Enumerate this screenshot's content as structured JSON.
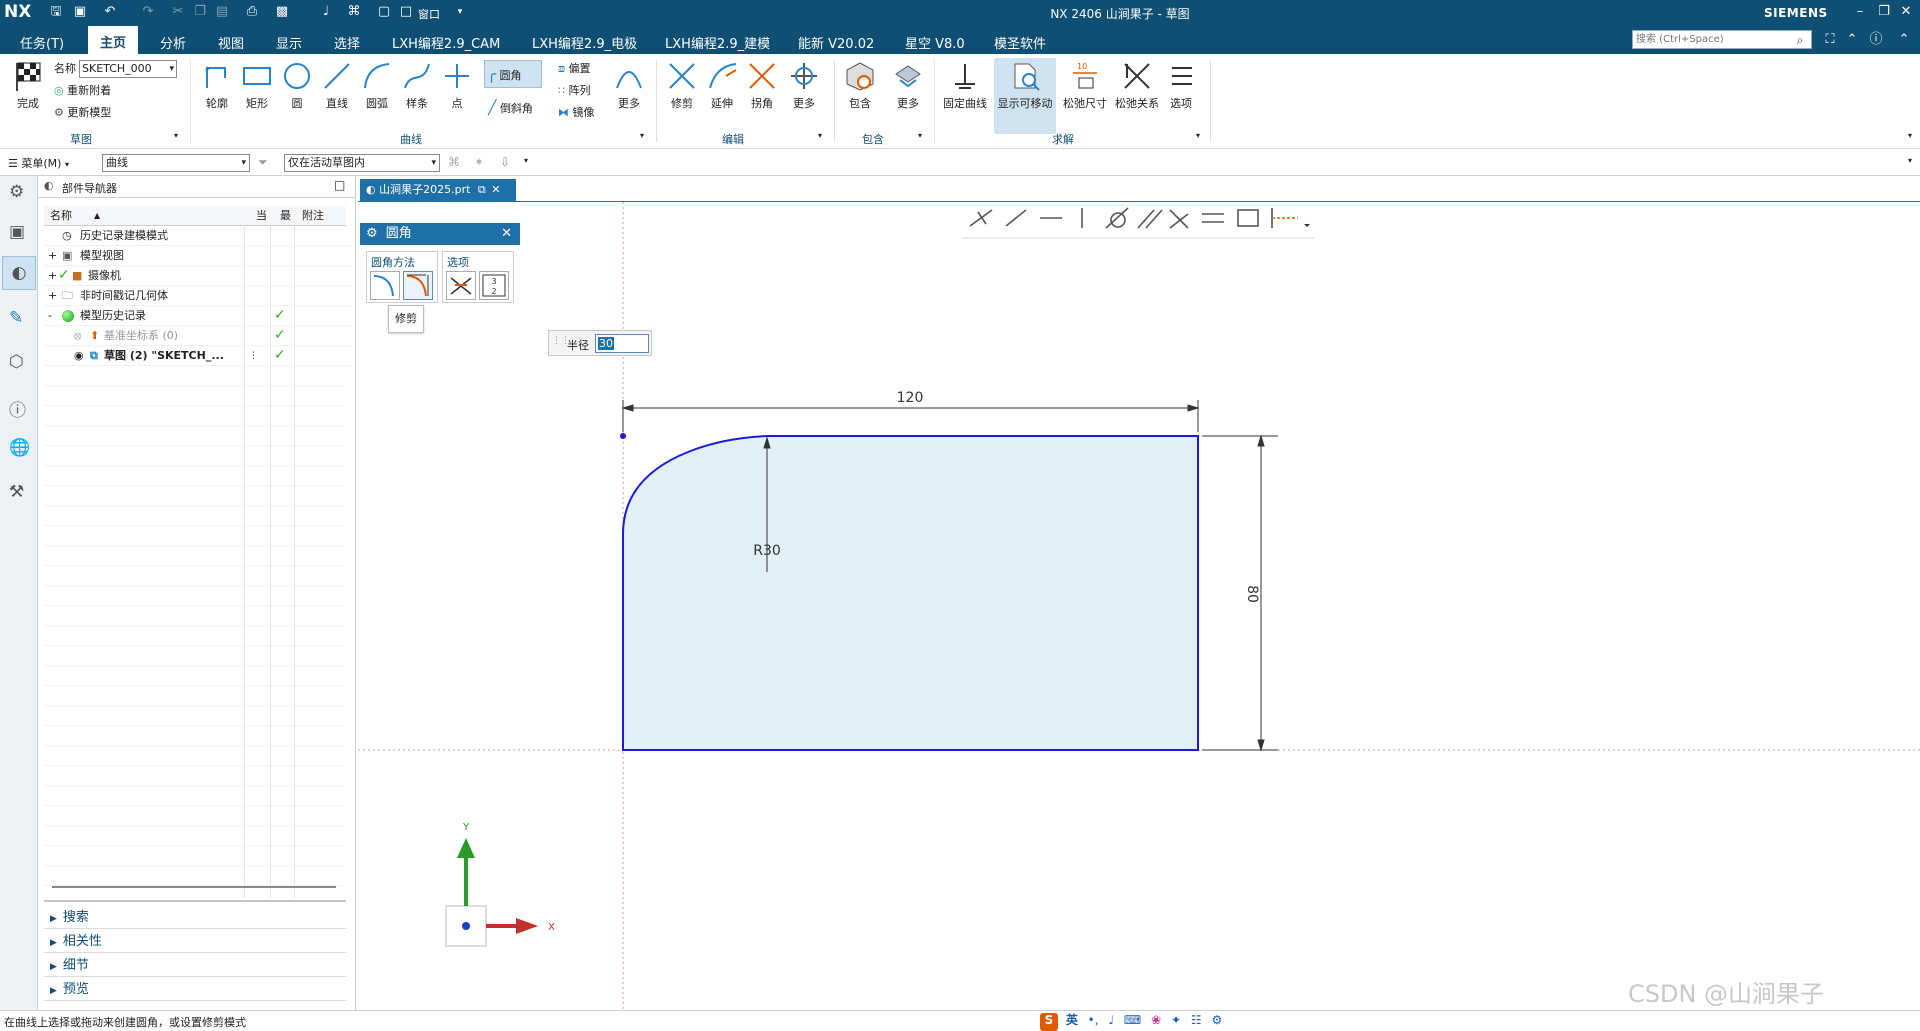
{
  "app": {
    "logo": "NX",
    "title": "NX 2406 山涧果子 - 草图",
    "brand": "SIEMENS"
  },
  "menubar": {
    "items": [
      "任务(T)",
      "主页",
      "分析",
      "视图",
      "显示",
      "选择",
      "LXH编程2.9_CAM",
      "LXH编程2.9_电极",
      "LXH编程2.9_建模",
      "能新 V20.02",
      "星空 V8.0",
      "模圣软件"
    ],
    "active": "主页"
  },
  "quick_access": {
    "window_label": "窗口"
  },
  "search": {
    "placeholder": "搜索 (Ctrl+Space)"
  },
  "ribbon": {
    "sketch_group": {
      "finish": "完成",
      "name_label": "名称",
      "name_value": "SKETCH_000",
      "reattach": "重新附着",
      "update_model": "更新模型",
      "label": "草图"
    },
    "curve_group": {
      "items": [
        "轮廓",
        "矩形",
        "圆",
        "直线",
        "圆弧",
        "样条",
        "点"
      ],
      "fillet": "圆角",
      "chamfer": "倒斜角",
      "offset": "偏置",
      "pattern": "阵列",
      "mirror": "镜像",
      "more": "更多",
      "label": "曲线"
    },
    "edit_group": {
      "items": [
        "修剪",
        "延伸",
        "拐角",
        "更多"
      ],
      "label": "编辑"
    },
    "include_group": {
      "items": [
        "包含",
        "更多"
      ],
      "label": "包含"
    },
    "solve_group": {
      "items": [
        "固定曲线",
        "显示可移动",
        "松弛尺寸",
        "松弛关系",
        "选项"
      ],
      "label": "求解"
    }
  },
  "selbar": {
    "menu": "菜单(M)",
    "filter": "曲线",
    "scope": "仅在活动草图内"
  },
  "navigator": {
    "title": "部件导航器",
    "columns": [
      "名称",
      "当",
      "最",
      "附注"
    ],
    "rows": [
      {
        "label": "历史记录建模模式",
        "expand": "",
        "check": false
      },
      {
        "label": "模型视图",
        "expand": "+",
        "check": false
      },
      {
        "label": "摄像机",
        "expand": "+",
        "check": false
      },
      {
        "label": "非时间戳记几何体",
        "expand": "+",
        "check": false
      },
      {
        "label": "模型历史记录",
        "expand": "-",
        "check": true
      },
      {
        "label": "基准坐标系 (0)",
        "expand": "",
        "check": true
      },
      {
        "label": "草图 (2) \"SKETCH_...",
        "expand": "",
        "check": true
      }
    ],
    "accordion": [
      "搜索",
      "相关性",
      "细节",
      "预览"
    ]
  },
  "doc_tab": {
    "label": "山涧果子2025.prt"
  },
  "fillet_dialog": {
    "title": "圆角",
    "method_label": "圆角方法",
    "options_label": "选项",
    "trim_label": "修剪"
  },
  "radius_input": {
    "label": "半径",
    "value": "30"
  },
  "dims": {
    "horizontal": "120",
    "vertical": "80",
    "radius": "R30"
  },
  "triad": {
    "x": "X",
    "y": "Y"
  },
  "status": {
    "message": "在曲线上选择或拖动来创建圆角，或设置修剪模式",
    "ime": "英"
  },
  "watermark": "CSDN @山涧果子",
  "colors": {
    "titlebar": "#0f4f73",
    "sketch_curve": "#1a1adc",
    "sketch_fill": "#e3f0f7",
    "accent": "#0f4f73"
  }
}
